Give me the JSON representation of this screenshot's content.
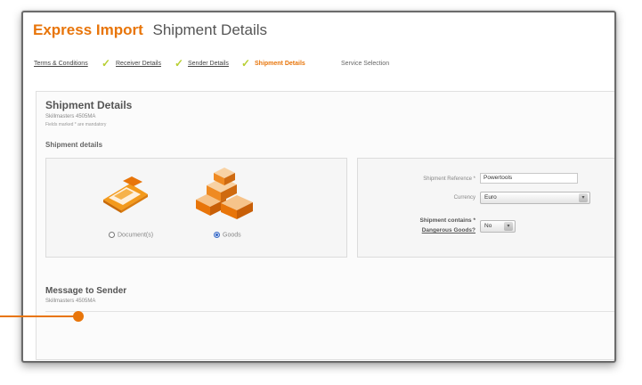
{
  "header": {
    "brand": "Express Import",
    "page_title": "Shipment Details"
  },
  "steps": [
    {
      "label": "Terms & Conditions",
      "state": "done"
    },
    {
      "label": "Receiver Details",
      "state": "done"
    },
    {
      "label": "Sender Details",
      "state": "done"
    },
    {
      "label": "Shipment Details",
      "state": "current"
    },
    {
      "label": "Service Selection",
      "state": "upcoming"
    }
  ],
  "shipment": {
    "title": "Shipment Details",
    "subtitle": "Skillmasters 4505MA",
    "note": "Fields marked * are mandatory",
    "section_heading": "Shipment details",
    "options": {
      "documents_label": "Document(s)",
      "goods_label": "Goods",
      "selected": "Goods"
    },
    "fields": {
      "reference_label": "Shipment Reference *",
      "reference_value": "Powertools",
      "currency_label": "Currency",
      "currency_value": "Euro",
      "dangerous_label": "Shipment contains *",
      "dangerous_link": "Dangerous Goods?",
      "dangerous_value": "No"
    }
  },
  "message": {
    "title": "Message to Sender",
    "subtitle": "Skillmasters 4505MA"
  },
  "colors": {
    "accent": "#e8750a",
    "check": "#b7cf32"
  }
}
